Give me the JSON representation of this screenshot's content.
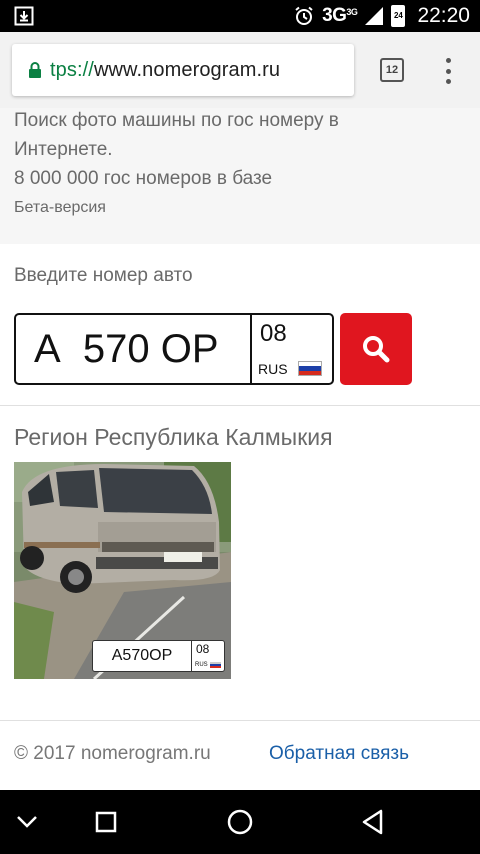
{
  "status_bar": {
    "network": "3G",
    "network_sup": "3G",
    "battery_level": "24",
    "time": "22:20"
  },
  "browser": {
    "url_scheme_part": "tps://",
    "url_host": "www.nomerogram.ru",
    "tab_count": "12"
  },
  "intro": {
    "description": "Поиск фото машины по гос номеру в Интернете.",
    "count_text": "8 000 000 гос номеров в базе",
    "beta_label": "Бета-версия"
  },
  "search": {
    "label": "Введите номер авто",
    "plate_number": "А  570 ОР",
    "plate_region": "08",
    "plate_country": "RUS"
  },
  "result": {
    "region_title": "Регион Республика Калмыкия",
    "photo_plate_number": "А570ОР",
    "photo_plate_region": "08",
    "photo_plate_country": "RUS"
  },
  "footer": {
    "copyright": "© 2017 nomerogram.ru",
    "feedback_link": "Обратная связь"
  },
  "colors": {
    "search_button": "#e0161f",
    "link": "#1a5fa8",
    "secure_scheme": "#0b8043"
  }
}
